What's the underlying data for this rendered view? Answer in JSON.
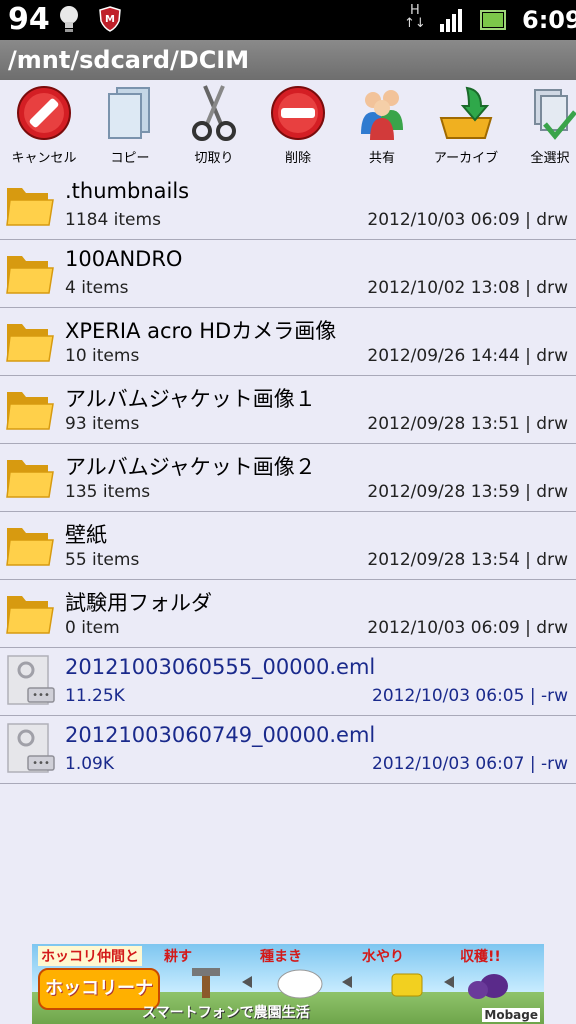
{
  "status_bar": {
    "battery_level": "94",
    "network_type": "H",
    "clock": "6:09",
    "icons": [
      "bulb-icon",
      "security-shield-icon",
      "network-arrows-icon",
      "signal-icon",
      "battery-icon"
    ]
  },
  "path": "/mnt/sdcard/DCIM",
  "toolbar": [
    {
      "label": "キャンセル",
      "icon": "cancel-icon"
    },
    {
      "label": "コピー",
      "icon": "copy-icon"
    },
    {
      "label": "切取り",
      "icon": "scissors-icon"
    },
    {
      "label": "削除",
      "icon": "delete-icon"
    },
    {
      "label": "共有",
      "icon": "share-icon"
    },
    {
      "label": "アーカイブ",
      "icon": "archive-icon"
    },
    {
      "label": "全選択",
      "icon": "select-all-icon"
    }
  ],
  "files": [
    {
      "name": ".thumbnails",
      "count": "1184 items",
      "meta": "2012/10/03 06:09 | drw",
      "type": "folder"
    },
    {
      "name": "100ANDRO",
      "count": "4 items",
      "meta": "2012/10/02 13:08 | drw",
      "type": "folder"
    },
    {
      "name": "XPERIA acro HDカメラ画像",
      "count": "10 items",
      "meta": "2012/09/26 14:44 | drw",
      "type": "folder"
    },
    {
      "name": "アルバムジャケット画像１",
      "count": "93 items",
      "meta": "2012/09/28 13:51 | drw",
      "type": "folder"
    },
    {
      "name": "アルバムジャケット画像２",
      "count": "135 items",
      "meta": "2012/09/28 13:59 | drw",
      "type": "folder"
    },
    {
      "name": "壁紙",
      "count": "55 items",
      "meta": "2012/09/28 13:54 | drw",
      "type": "folder"
    },
    {
      "name": "試験用フォルダ",
      "count": "0 item",
      "meta": "2012/10/03 06:09 | drw",
      "type": "folder"
    },
    {
      "name": "20121003060555_00000.eml",
      "count": "11.25K",
      "meta": "2012/10/03 06:05 | -rw",
      "type": "file"
    },
    {
      "name": "20121003060749_00000.eml",
      "count": "1.09K",
      "meta": "2012/10/03 06:07 | -rw",
      "type": "file"
    }
  ],
  "ad": {
    "top_text": "ホッコリ仲間と",
    "logo_text": "ホッコリーナ",
    "steps": [
      "耕す",
      "種まき",
      "水やり",
      "収穫!!"
    ],
    "bottom_text": "スマートフォンで農園生活",
    "brand": "Mobage"
  }
}
